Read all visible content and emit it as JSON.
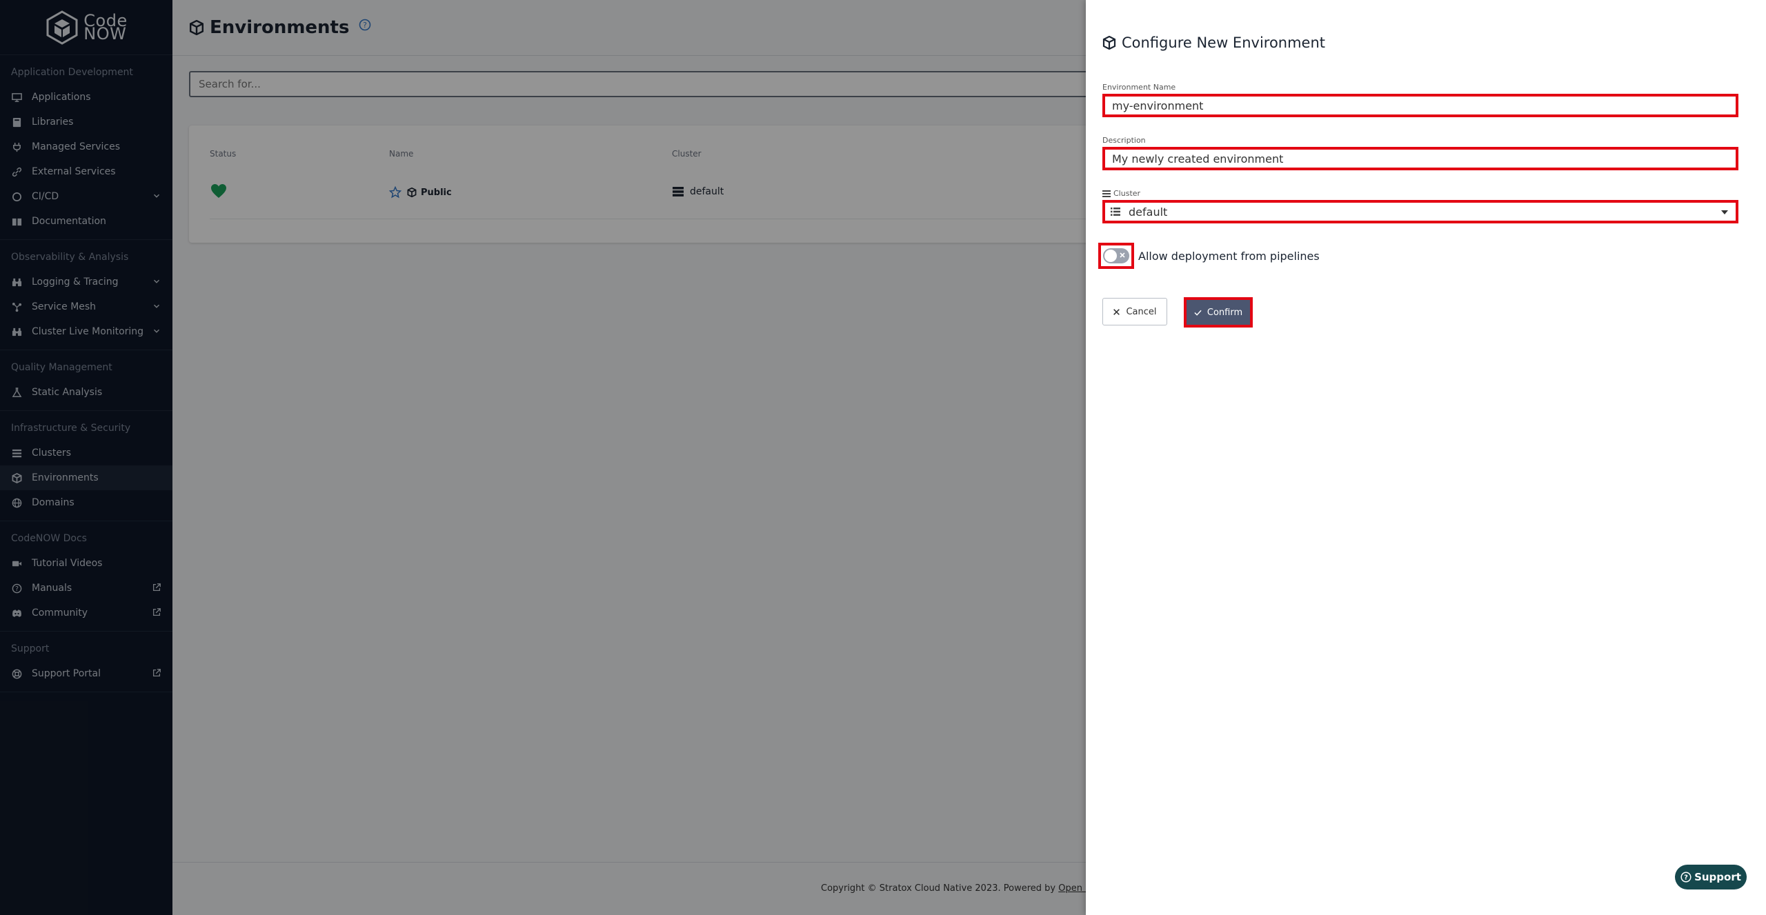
{
  "brand": {
    "line1": "Code",
    "line2": "NOW"
  },
  "sidebar": {
    "sections": [
      {
        "title": "Application Development",
        "items": [
          {
            "label": "Applications",
            "icon": "monitor-icon"
          },
          {
            "label": "Libraries",
            "icon": "book-icon"
          },
          {
            "label": "Managed Services",
            "icon": "plug-icon"
          },
          {
            "label": "External Services",
            "icon": "link-icon"
          },
          {
            "label": "CI/CD",
            "icon": "circle-icon",
            "trail": "chevron-down-icon"
          },
          {
            "label": "Documentation",
            "icon": "book-open-icon"
          }
        ]
      },
      {
        "title": "Observability & Analysis",
        "items": [
          {
            "label": "Logging & Tracing",
            "icon": "binoculars-icon",
            "trail": "chevron-down-icon"
          },
          {
            "label": "Service Mesh",
            "icon": "network-icon",
            "trail": "chevron-down-icon"
          },
          {
            "label": "Cluster Live Monitoring",
            "icon": "binoculars-icon",
            "trail": "chevron-down-icon"
          }
        ]
      },
      {
        "title": "Quality Management",
        "items": [
          {
            "label": "Static Analysis",
            "icon": "flask-icon"
          }
        ]
      },
      {
        "title": "Infrastructure & Security",
        "items": [
          {
            "label": "Clusters",
            "icon": "server-icon"
          },
          {
            "label": "Environments",
            "icon": "cube-icon",
            "active": true
          },
          {
            "label": "Domains",
            "icon": "globe-icon"
          }
        ]
      },
      {
        "title": "CodeNOW Docs",
        "items": [
          {
            "label": "Tutorial Videos",
            "icon": "video-icon"
          },
          {
            "label": "Manuals",
            "icon": "question-circle-icon",
            "trail": "external-link-icon"
          },
          {
            "label": "Community",
            "icon": "discord-icon",
            "trail": "external-link-icon"
          }
        ]
      },
      {
        "title": "Support",
        "items": [
          {
            "label": "Support Portal",
            "icon": "lifebuoy-icon",
            "trail": "external-link-icon"
          }
        ]
      }
    ]
  },
  "page": {
    "title": "Environments",
    "search_placeholder": "Search for...",
    "table": {
      "columns": [
        "Status",
        "Name",
        "Cluster"
      ],
      "rows": [
        {
          "status": "healthy",
          "name": "Public",
          "cluster": "default"
        }
      ]
    },
    "footer": {
      "text": "Copyright © Stratox Cloud Native 2023. Powered by ",
      "link": "Open Source S"
    }
  },
  "drawer": {
    "title": "Configure New Environment",
    "fields": {
      "name": {
        "label": "Environment Name",
        "value": "my-environment"
      },
      "description": {
        "label": "Description",
        "value": "My newly created environment"
      },
      "cluster": {
        "label": "Cluster",
        "value": "default"
      }
    },
    "toggle": {
      "label": "Allow deployment from pipelines",
      "on": false
    },
    "cancel_label": "Cancel",
    "confirm_label": "Confirm"
  },
  "support_label": "Support",
  "colors": {
    "sidebar_bg": "#0f1828",
    "highlight": "#e30613",
    "confirm_bg": "#4b5670",
    "status_green": "#1aa05b",
    "support_bg": "#16484d"
  }
}
